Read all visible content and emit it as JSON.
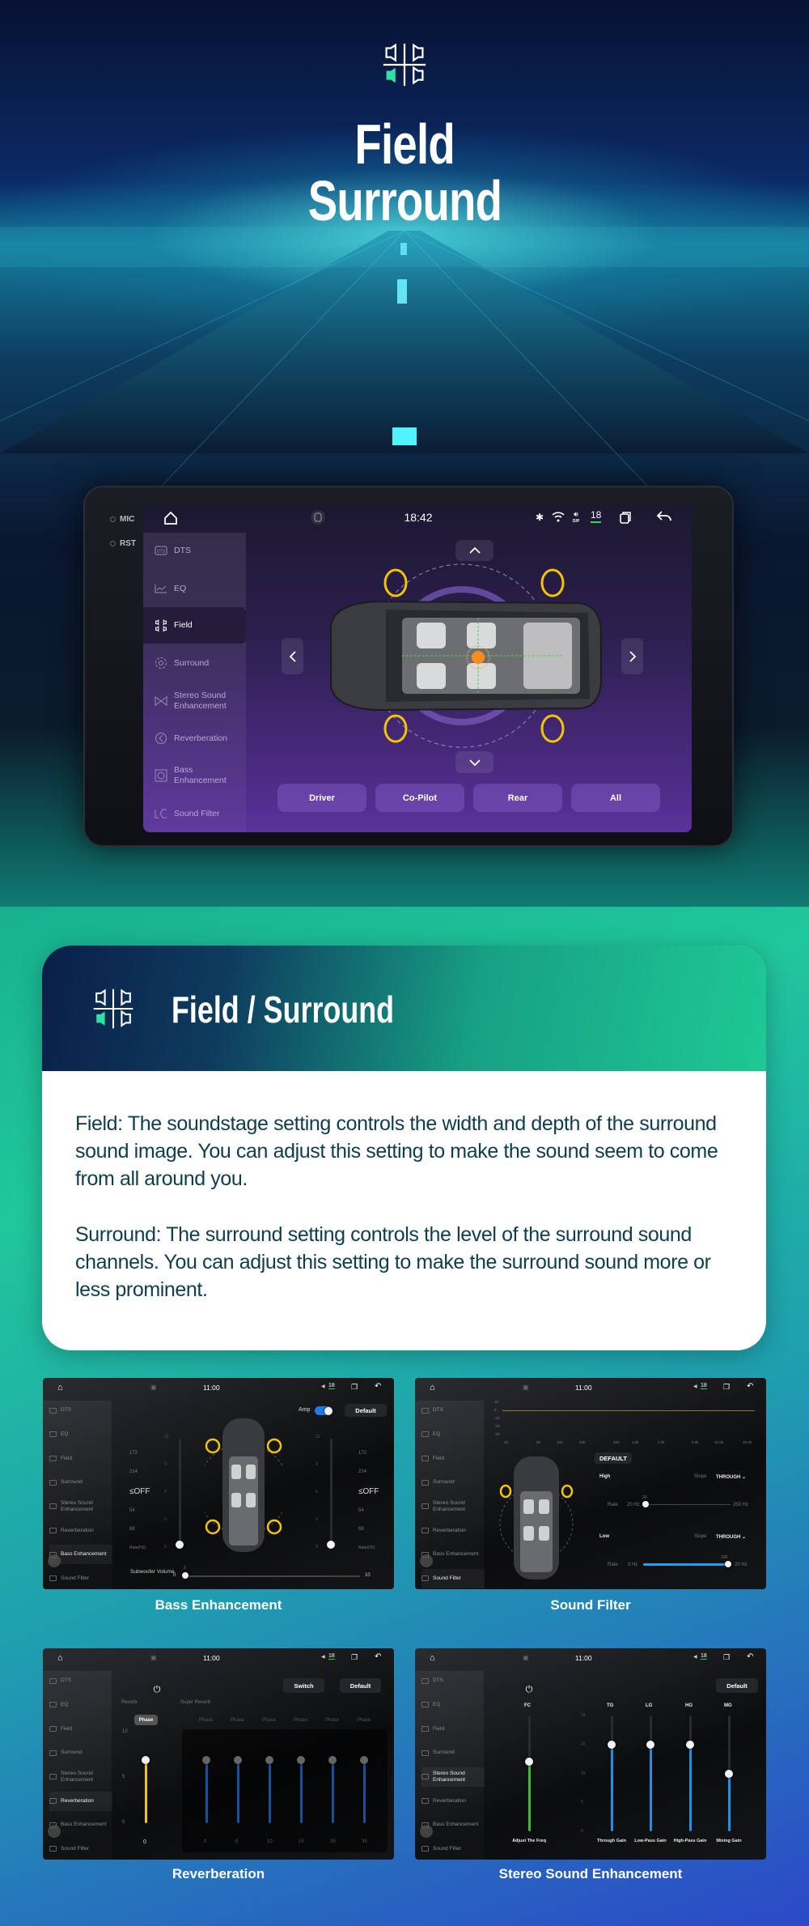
{
  "hero": {
    "title_line1": "Field",
    "title_line2": "Surround",
    "logo_icon": "field-speakers-icon",
    "accent": "#2fe0a6"
  },
  "head_unit": {
    "bezel_labels": [
      "MIC",
      "RST"
    ],
    "status": {
      "time": "18:42",
      "volume": "18",
      "volume_sub": "D/P"
    },
    "sidebar": [
      {
        "label": "DTS",
        "icon": "dts-icon"
      },
      {
        "label": "EQ",
        "icon": "eq-icon"
      },
      {
        "label": "Field",
        "icon": "field-icon",
        "active": true
      },
      {
        "label": "Surround",
        "icon": "surround-icon"
      },
      {
        "label": "Stereo Sound Enhancement",
        "icon": "stereo-icon"
      },
      {
        "label": "Reverberation",
        "icon": "reverb-icon"
      },
      {
        "label": "Bass Enhancement",
        "icon": "bass-icon"
      },
      {
        "label": "Sound Filter",
        "icon": "filter-icon"
      }
    ],
    "position_buttons": [
      "Driver",
      "Co-Pilot",
      "Rear",
      "All"
    ],
    "speaker_color": "#f5c400",
    "listener_color": "#ff8a1e"
  },
  "card": {
    "title": "Field / Surround",
    "paragraphs": [
      "Field: The soundstage setting controls the width and depth of the surround sound image. You can adjust this setting to make the sound seem to come from all around you.",
      "Surround: The surround setting controls the level of the surround sound channels. You can adjust this setting to make the surround sound more or less prominent."
    ]
  },
  "thumb_common": {
    "time": "11:00",
    "volume": "18",
    "sidebar": [
      "DTS",
      "EQ",
      "Field",
      "Surround",
      "Stereo Sound Enhancement",
      "Reverberation",
      "Bass Enhancement",
      "Sound Filter"
    ]
  },
  "thumbs": [
    {
      "caption": "Bass Enhancement",
      "amp_label": "Amp",
      "amp_on": true,
      "default": "Default",
      "freq_labels": [
        "172",
        "214",
        "≤OFF",
        "54",
        "68",
        "Rate(HZ)"
      ],
      "scale": [
        "12",
        "9",
        "6",
        "3",
        "0"
      ],
      "sub_label": "Subwoofer Volume",
      "sub_min": "0",
      "sub_max": "10",
      "sub_value": "0"
    },
    {
      "caption": "Sound Filter",
      "graph_y": [
        "10",
        "0",
        "-10",
        "-20",
        "-30"
      ],
      "graph_x": [
        "20",
        "50",
        "100",
        "200",
        "500",
        "1.0k",
        "2.0k",
        "5.0k",
        "10.0k",
        "20.0k"
      ],
      "default": "DEFAULT",
      "high": "High",
      "low": "Low",
      "slope": "Slope",
      "slope_value": "THROUGH",
      "rate": "Rate",
      "high_min": "20 Hz",
      "high_value": "20",
      "high_max": "250 Hz",
      "low_min": "3 Hz",
      "low_value": "200",
      "low_max": "20 Hz"
    },
    {
      "caption": "Reverberation",
      "switch": "Switch",
      "default": "Default",
      "reverb": "Reverb",
      "super_reverb": "Super Reverb",
      "phase": "Phase",
      "scale": [
        "10",
        "5",
        "0"
      ],
      "value": "0",
      "super_values": [
        "0",
        "5",
        "10",
        "15",
        "25",
        "35"
      ]
    },
    {
      "caption": "Stereo Sound Enhancement",
      "default": "Default",
      "sliders": [
        {
          "key": "FC",
          "label": "Adjust The Freq",
          "level": 0.6,
          "color": "#3bbf2a"
        },
        {
          "key": "TG",
          "label": "Through Gain",
          "level": 0.75,
          "color": "#1e90e8"
        },
        {
          "key": "LG",
          "label": "Low-Pass Gain",
          "level": 0.75,
          "color": "#1e90e8"
        },
        {
          "key": "HG",
          "label": "High-Pass Gain",
          "level": 0.75,
          "color": "#1e90e8"
        },
        {
          "key": "MG",
          "label": "Mixing Gain",
          "level": 0.5,
          "color": "#1e90e8"
        }
      ],
      "scale": [
        "20",
        "15",
        "10",
        "5",
        "0"
      ]
    }
  ]
}
